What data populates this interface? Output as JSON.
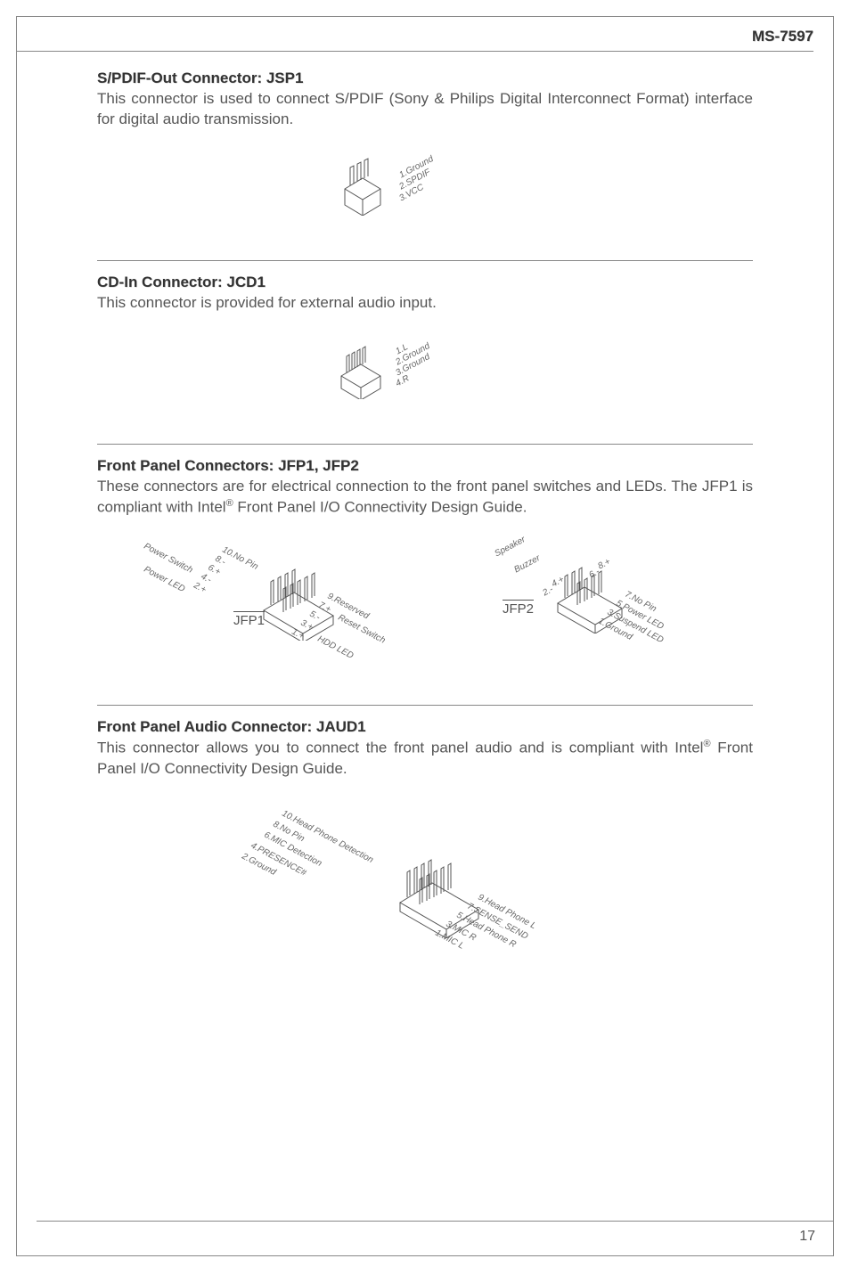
{
  "header": {
    "model": "MS-7597"
  },
  "footer": {
    "page": "17"
  },
  "sections": {
    "spdif": {
      "title": "S/PDIF-Out Connector: JSP1",
      "desc": "This connector is used to connect S/PDIF (Sony & Philips Digital Interconnect Format) interface for digital audio transmission.",
      "pins": {
        "p1": "1.Ground",
        "p2": "2.SPDIF",
        "p3": "3.VCC"
      }
    },
    "cdin": {
      "title": "CD-In Connector: JCD1",
      "desc": "This connector is provided for external audio input.",
      "pins": {
        "p1": "1.L",
        "p2": "2.Ground",
        "p3": "3.Ground",
        "p4": "4.R"
      }
    },
    "frontpanel": {
      "title": "Front Panel Connectors: JFP1, JFP2",
      "desc_a": "These connectors are for electrical connection to the front panel switches and LEDs. The JFP1 is compliant with Intel",
      "desc_b": " Front Panel I/O Connectivity Design Guide.",
      "jfp1": {
        "label": "JFP1",
        "top": {
          "t1": "Power Switch",
          "t2": "Power LED",
          "p10": "10.No Pin",
          "p8": "8.-",
          "p6": "6.+",
          "p4": "4.-",
          "p2": "2.+"
        },
        "bot": {
          "p9": "9.Reserved",
          "p7": "7.+",
          "p5": "5.-",
          "p3": "3.+",
          "p1": "1.+",
          "b1": "Reset Switch",
          "b2": "HDD LED"
        }
      },
      "jfp2": {
        "label": "JFP2",
        "top": {
          "t1": "Speaker",
          "t2": "Buzzer",
          "p8": "8.+",
          "p6": "6.-",
          "p4": "4.+",
          "p2": "2.-"
        },
        "bot": {
          "p7": "7.No Pin",
          "p5": "5.Power LED",
          "p3": "3.Suspend LED",
          "p1": "1.Ground"
        }
      }
    },
    "jaud": {
      "title": "Front Panel Audio Connector: JAUD1",
      "desc_a": "This connector allows you to connect the front panel audio and is compliant with Intel",
      "desc_b": " Front Panel I/O Connectivity Design Guide.",
      "pins": {
        "p10": "10.Head Phone Detection",
        "p8": "8.No Pin",
        "p6": "6.MIC Detection",
        "p4": "4.PRESENCE#",
        "p2": "2.Ground",
        "p9": "9.Head Phone L",
        "p7": "7.SENSE_SEND",
        "p5": "5.Head Phone R",
        "p3": "3.MIC R",
        "p1": "1.MIC L"
      }
    }
  }
}
